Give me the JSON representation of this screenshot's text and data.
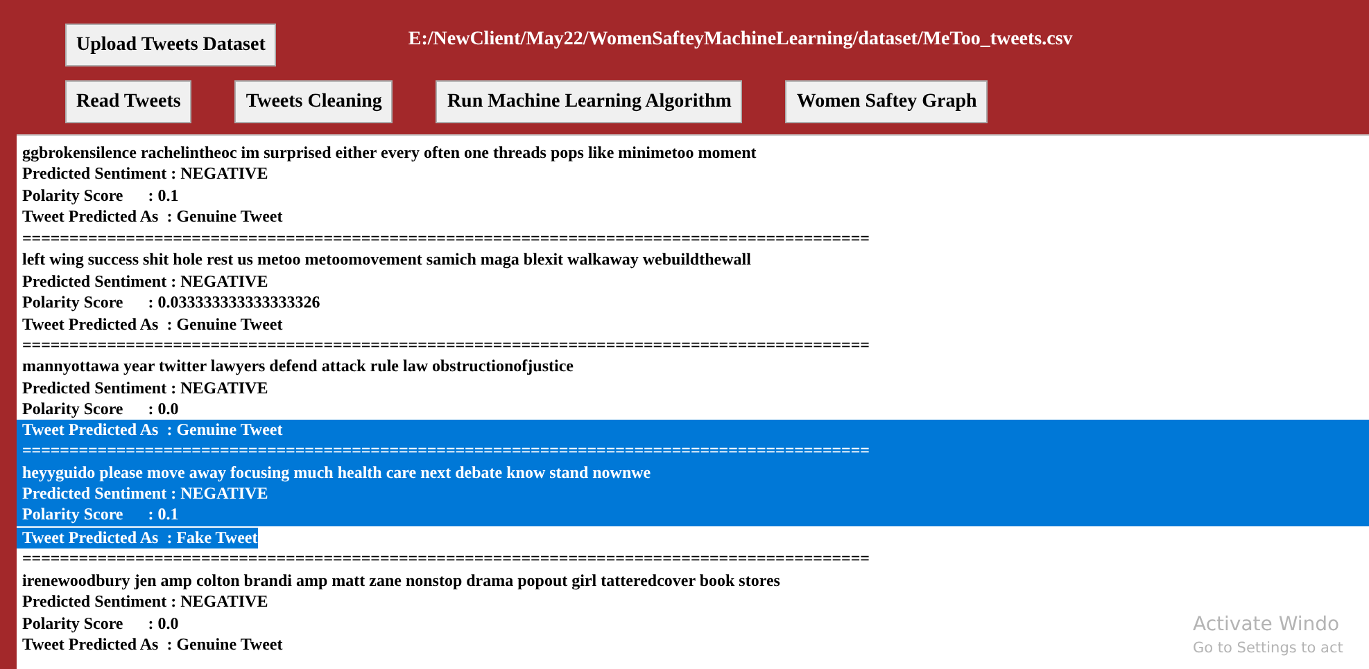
{
  "toolbar": {
    "buttons": [
      {
        "label": "Upload Tweets Dataset"
      },
      {
        "label": "Read Tweets"
      },
      {
        "label": "Tweets Cleaning"
      },
      {
        "label": "Run Machine Learning Algorithm"
      },
      {
        "label": "Women Saftey Graph"
      }
    ],
    "path_label": "E:/NewClient/May22/WomenSafteyMachineLearning/dataset/MeToo_tweets.csv"
  },
  "output": {
    "lines": [
      {
        "kind": "text",
        "text": "ggbrokensilence rachelintheoc im surprised either every often one threads pops like minimetoo moment",
        "selected": false
      },
      {
        "kind": "text",
        "text": "Predicted Sentiment : NEGATIVE",
        "selected": false
      },
      {
        "kind": "text",
        "text": "Polarity Score      : 0.1",
        "selected": false
      },
      {
        "kind": "text",
        "text": "Tweet Predicted As  : Genuine Tweet",
        "selected": false
      },
      {
        "kind": "separator",
        "text": "==========================================================================================",
        "selected": false
      },
      {
        "kind": "text",
        "text": "left wing success shit hole rest us metoo metoomovement samich maga blexit walkaway webuildthewall",
        "selected": false
      },
      {
        "kind": "text",
        "text": "Predicted Sentiment : NEGATIVE",
        "selected": false
      },
      {
        "kind": "text",
        "text": "Polarity Score      : 0.033333333333333326",
        "selected": false
      },
      {
        "kind": "text",
        "text": "Tweet Predicted As  : Genuine Tweet",
        "selected": false
      },
      {
        "kind": "separator",
        "text": "==========================================================================================",
        "selected": false
      },
      {
        "kind": "text",
        "text": "mannyottawa year twitter lawyers defend attack rule law obstructionofjustice",
        "selected": false
      },
      {
        "kind": "text",
        "text": "Predicted Sentiment : NEGATIVE",
        "selected": false
      },
      {
        "kind": "text",
        "text": "Polarity Score      : 0.0",
        "selected": false
      },
      {
        "kind": "text",
        "text": "Tweet Predicted As  : Genuine Tweet",
        "selected": true
      },
      {
        "kind": "separator",
        "text": "==========================================================================================",
        "selected": true
      },
      {
        "kind": "text",
        "text": "heyyguido please move away focusing much health care next debate know stand nownwe",
        "selected": true
      },
      {
        "kind": "text",
        "text": "Predicted Sentiment : NEGATIVE",
        "selected": true
      },
      {
        "kind": "text",
        "text": "Polarity Score      : 0.1",
        "selected": true
      },
      {
        "kind": "text",
        "text": "Tweet Predicted As  : Fake Tweet",
        "selected": true
      },
      {
        "kind": "separator",
        "text": "==========================================================================================",
        "selected": false
      },
      {
        "kind": "text",
        "text": "irenewoodbury jen amp colton brandi amp matt zane nonstop drama popout girl tatteredcover book stores",
        "selected": false
      },
      {
        "kind": "text",
        "text": "Predicted Sentiment : NEGATIVE",
        "selected": false
      },
      {
        "kind": "text",
        "text": "Polarity Score      : 0.0",
        "selected": false
      },
      {
        "kind": "text",
        "text": "Tweet Predicted As  : Genuine Tweet",
        "selected": false
      }
    ]
  },
  "activation_notice": {
    "title": "Activate Windo",
    "subtitle": "Go to Settings to act"
  }
}
